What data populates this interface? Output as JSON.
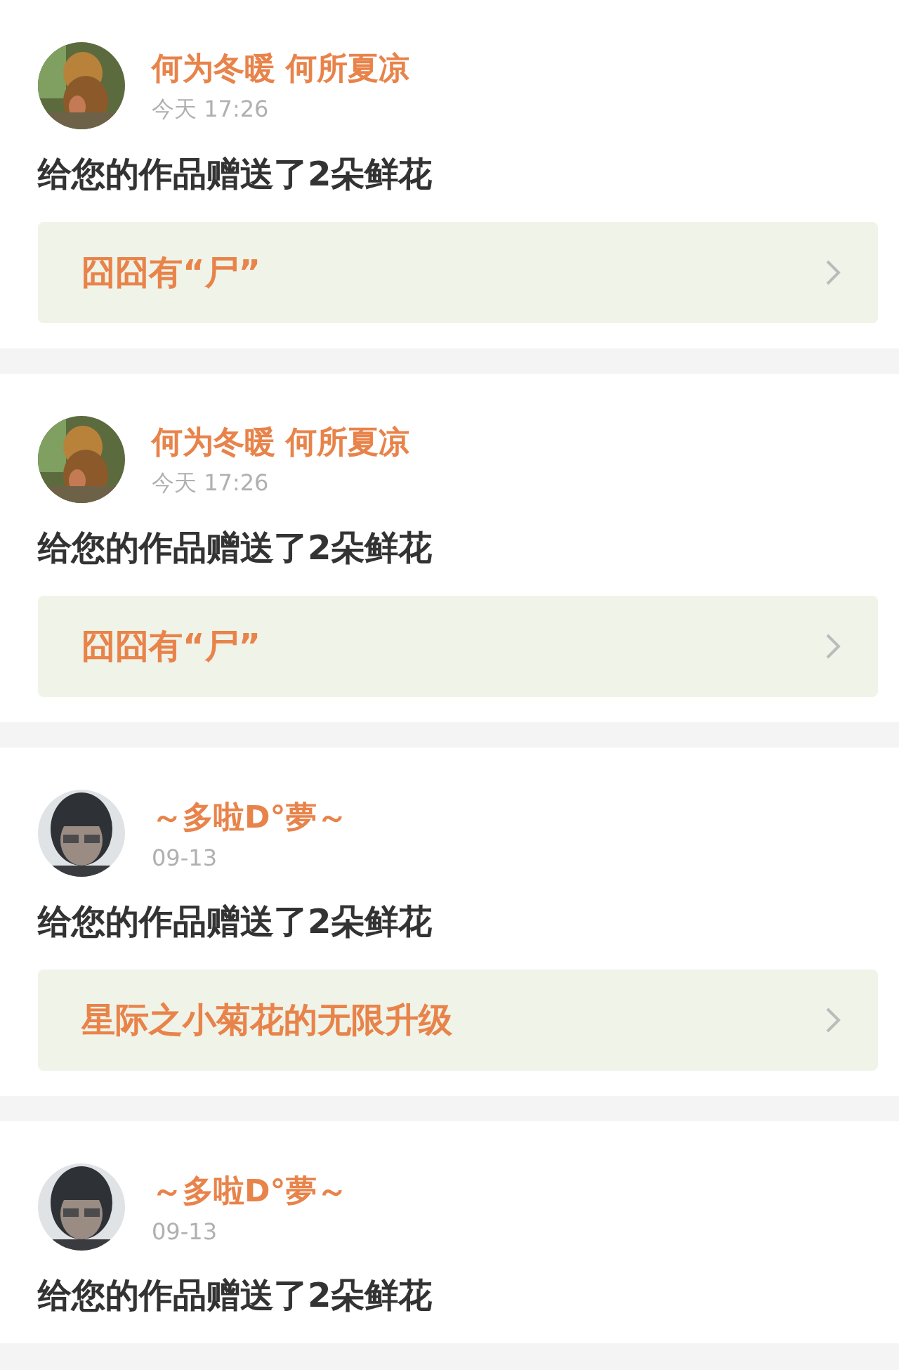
{
  "notifications": [
    {
      "user": "何为冬暖 何所夏凉",
      "time": "今天 17:26",
      "message": "给您的作品赠送了2朵鲜花",
      "work": {
        "title": "囧囧有“尸”"
      }
    },
    {
      "user": "何为冬暖 何所夏凉",
      "time": "今天 17:26",
      "message": "给您的作品赠送了2朵鲜花",
      "work": {
        "title": "囧囧有“尸”"
      }
    },
    {
      "user": "～多啦D°夢～",
      "time": "09-13",
      "message": "给您的作品赠送了2朵鲜花",
      "work": {
        "title": "星际之小菊花的无限升级"
      }
    },
    {
      "user": "～多啦D°夢～",
      "time": "09-13",
      "message": "给您的作品赠送了2朵鲜花"
    }
  ]
}
